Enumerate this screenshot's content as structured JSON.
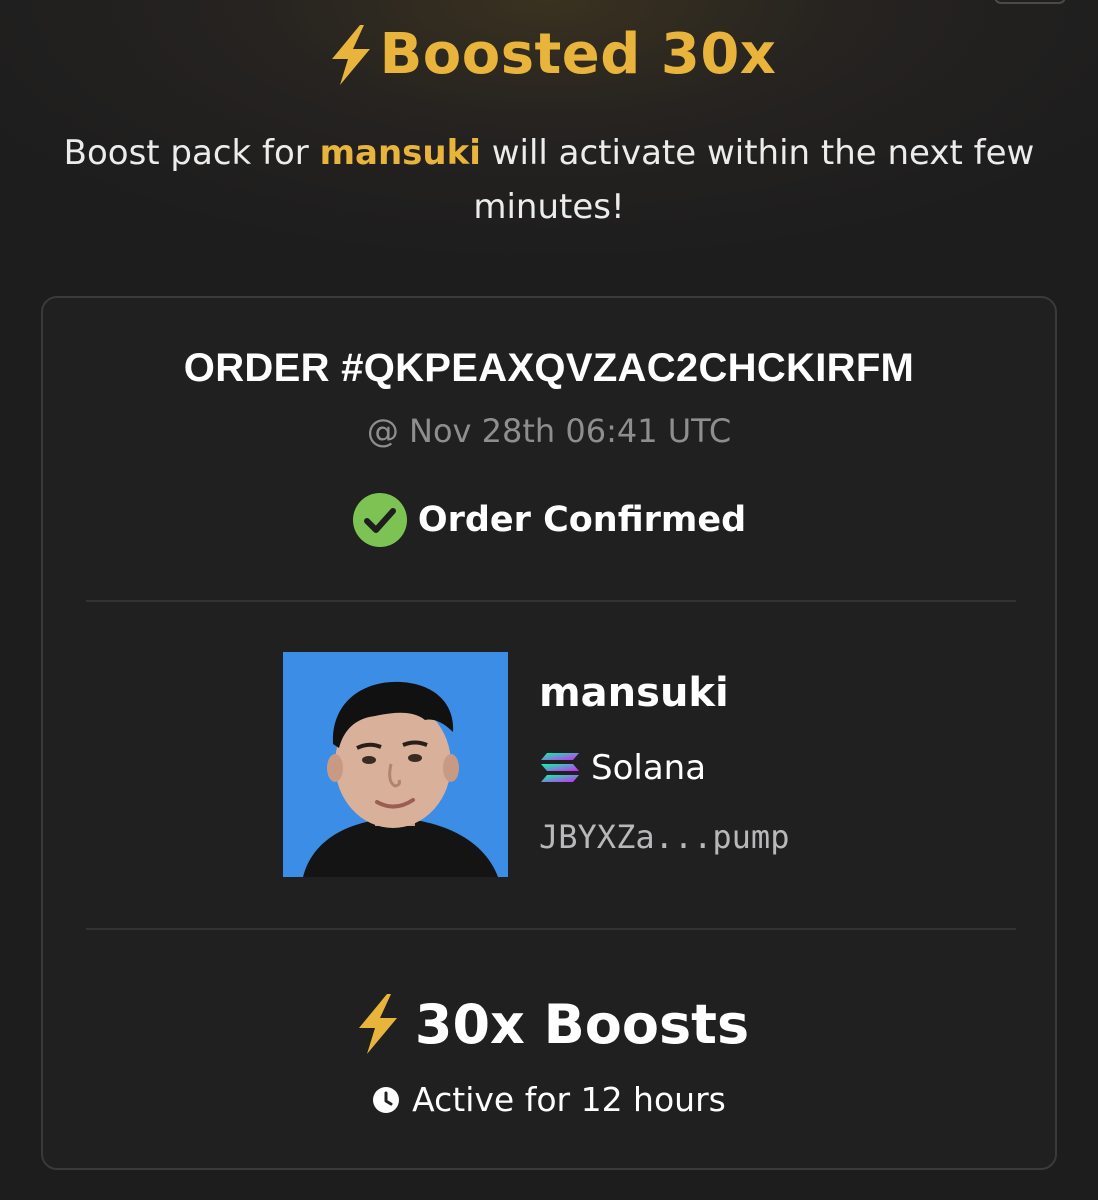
{
  "header": {
    "title": "Boosted 30x",
    "icon": "lightning-bolt-icon",
    "accent_color": "#e8b43c"
  },
  "subtitle": {
    "prefix": "Boost pack for ",
    "token": "mansuki",
    "suffix": " will activate within the next few minutes!"
  },
  "order": {
    "id": "ORDER #QKPEAXQVZAC2CHCKIRFM",
    "time": "@ Nov 28th 06:41 UTC",
    "status": "Order Confirmed",
    "status_icon": "check-circle-icon",
    "status_color": "#7dc353"
  },
  "token": {
    "name": "mansuki",
    "chain": "Solana",
    "chain_icon": "solana-icon",
    "address": "JBYXZa...pump",
    "avatar_background": "#3b8de6"
  },
  "boost": {
    "label": "30x Boosts",
    "icon": "lightning-bolt-icon",
    "duration": "Active for 12 hours",
    "duration_icon": "clock-icon"
  }
}
